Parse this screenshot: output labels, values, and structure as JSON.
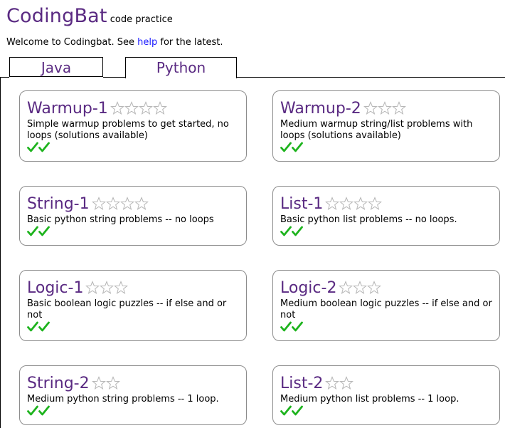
{
  "header": {
    "brand": "CodingBat",
    "tagline": "code practice"
  },
  "welcome": {
    "prefix": "Welcome to Codingbat. See ",
    "link": "help",
    "suffix": " for the latest."
  },
  "tabs": [
    {
      "label": "Java",
      "active": false
    },
    {
      "label": "Python",
      "active": true
    }
  ],
  "colors": {
    "brand": "#5a2a82",
    "link": "#1a1aff",
    "check": "#1db31d"
  },
  "sections": [
    {
      "title": "Warmup-1",
      "stars": 4,
      "description": "Simple warmup problems to get started, no loops (solutions available)",
      "checks": 2
    },
    {
      "title": "Warmup-2",
      "stars": 3,
      "description": "Medium warmup string/list problems with loops (solutions available)",
      "checks": 2
    },
    {
      "title": "String-1",
      "stars": 4,
      "description": "Basic python string problems -- no loops",
      "checks": 2
    },
    {
      "title": "List-1",
      "stars": 4,
      "description": "Basic python list problems -- no loops.",
      "checks": 2
    },
    {
      "title": "Logic-1",
      "stars": 3,
      "description": "Basic boolean logic puzzles -- if else and or not",
      "checks": 2
    },
    {
      "title": "Logic-2",
      "stars": 3,
      "description": "Medium boolean logic puzzles -- if else and or not",
      "checks": 2
    },
    {
      "title": "String-2",
      "stars": 2,
      "description": "Medium python string problems -- 1 loop.",
      "checks": 2
    },
    {
      "title": "List-2",
      "stars": 2,
      "description": "Medium python list problems -- 1 loop.",
      "checks": 2
    }
  ]
}
